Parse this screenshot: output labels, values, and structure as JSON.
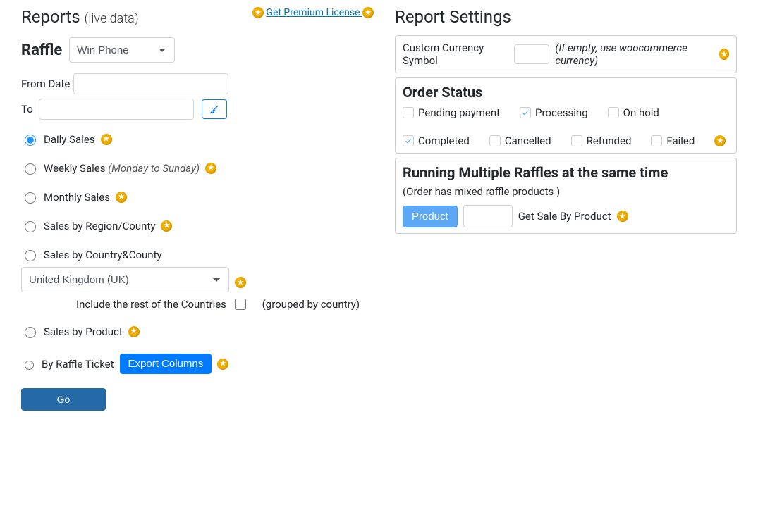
{
  "reports_title": "Reports",
  "reports_sub": "(live data)",
  "premium_link": "Get Premium License ",
  "raffle_label": "Raffle",
  "raffle_selected": "Win Phone",
  "from_label": "From Date",
  "to_label": "To",
  "options": {
    "daily": "Daily Sales",
    "weekly_prefix": "Weekly Sales ",
    "weekly_em": "(Monday to Sunday)",
    "monthly": "Monthly Sales",
    "region": "Sales by Region/County",
    "country": "Sales by Country&County",
    "product": "Sales by Product",
    "ticket": "By Raffle Ticket"
  },
  "country_selected": "United Kingdom (UK)",
  "include_rest": "Include the rest of the Countries",
  "grouped_by": "(grouped by country)",
  "export_btn": "Export Columns",
  "go_btn": "Go",
  "settings_title": "Report Settings",
  "currency": {
    "label": "Custom Currency Symbol",
    "value": "",
    "hint": "(If empty, use woocommerce currency)"
  },
  "order_status_title": "Order Status",
  "statuses": {
    "pending": {
      "label": "Pending payment",
      "checked": false
    },
    "processing": {
      "label": "Processing",
      "checked": true
    },
    "onhold": {
      "label": "On hold",
      "checked": false
    },
    "completed": {
      "label": "Completed",
      "checked": true
    },
    "cancelled": {
      "label": "Cancelled",
      "checked": false
    },
    "refunded": {
      "label": "Refunded",
      "checked": false
    },
    "failed": {
      "label": "Failed",
      "checked": false
    }
  },
  "multi_title": "Running Multiple Raffles at the same time",
  "multi_hint": "(Order has mixed raffle products )",
  "product_btn": "Product",
  "get_sale_label": "Get Sale By Product"
}
